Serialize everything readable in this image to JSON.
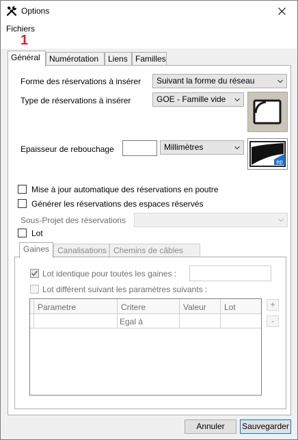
{
  "window": {
    "title": "Options",
    "title_icon": "tools-icon",
    "close_icon": "close-icon"
  },
  "menu": {
    "items": [
      "Fichiers"
    ]
  },
  "annotation": {
    "step": "1",
    "color": "#e02020"
  },
  "tabs": [
    "Général",
    "Numérotation",
    "Liens",
    "Familles"
  ],
  "general": {
    "forme_label": "Forme des réservations à insérer",
    "forme_value": "Suivant la forme du réseau",
    "type_label": "Type de réservations à insérer",
    "type_value": "GOE - Famille vide",
    "epaisseur_label": "Epaisseur de rebouchage",
    "epaisseur_value": "",
    "unit_value": "Millimètres",
    "maj_label": "Mise à jour automatique des réservations en poutre",
    "generer_label": "Générer les réservations des espaces réservés",
    "sousprojet_label": "Sous-Projet des réservations",
    "sousprojet_value": "",
    "lot_label": "Lot"
  },
  "subtabs": [
    "Gaines",
    "Canalisations",
    "Chemins de câbles"
  ],
  "gaines": {
    "lot_identique_label": "Lot identique pour toutes les gaines :",
    "lot_identique_value": "",
    "lot_different_label": "Lot différent suivant les paramètres suivants :",
    "columns": [
      "Parametre",
      "Critere",
      "Valeur",
      "Lot"
    ],
    "rows": [
      {
        "parametre": "",
        "critere": "Egal à",
        "valeur": "",
        "lot": ""
      }
    ],
    "add_label": "+",
    "remove_label": "-"
  },
  "buttons": {
    "cancel": "Annuler",
    "save": "Sauvegarder"
  },
  "colors": {
    "accent": "#0078d7",
    "preview_bg": "#c8c6b8",
    "preview_blue": "#1e6fd0"
  }
}
